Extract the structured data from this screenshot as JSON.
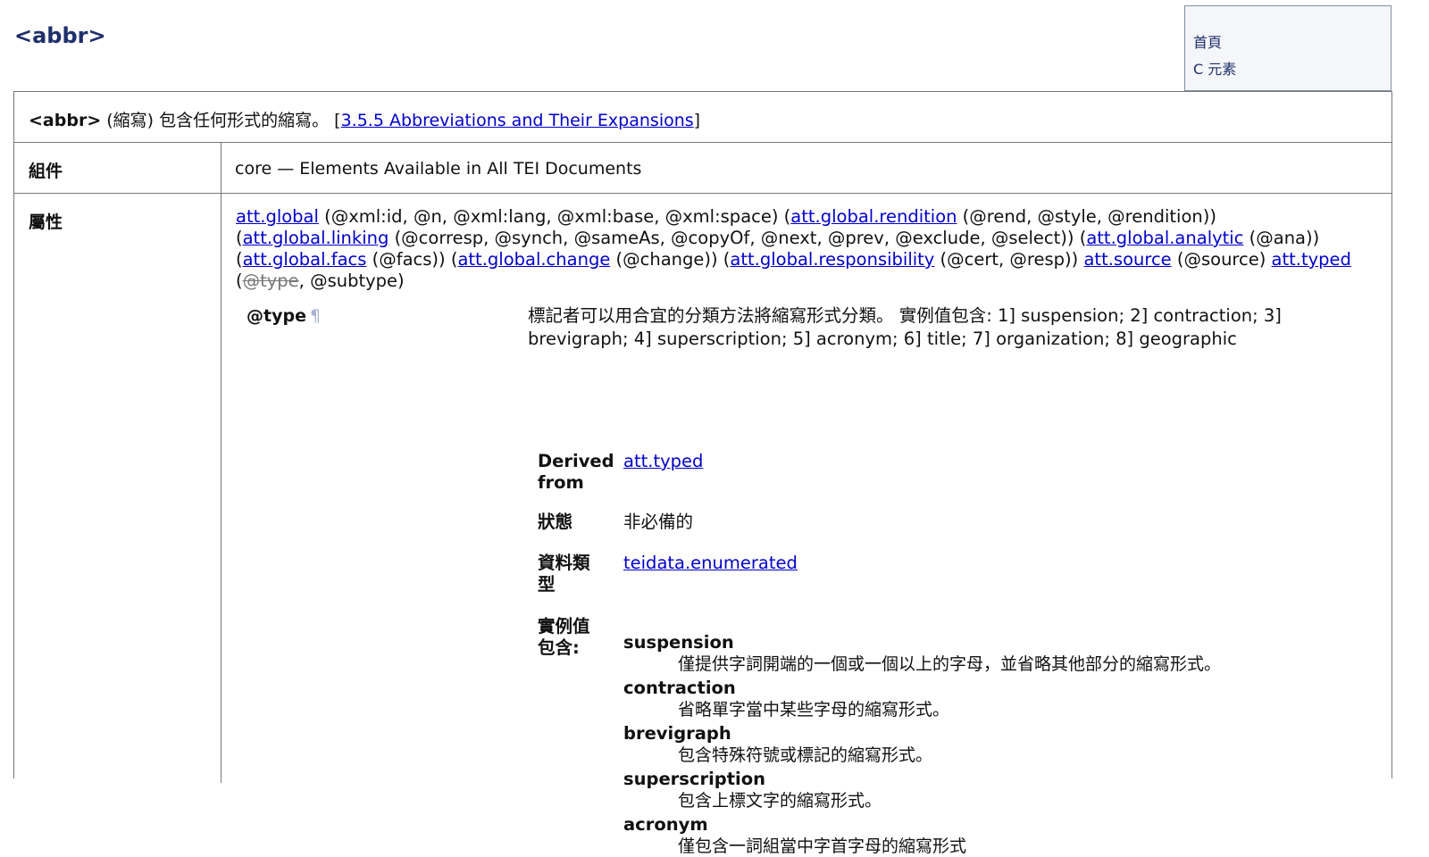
{
  "page": {
    "title": "<abbr>"
  },
  "nav": {
    "items": [
      "首頁",
      "C 元素"
    ]
  },
  "header_row": {
    "element": "<abbr>",
    "gloss": " (縮寫) 包含任何形式的縮寫。 [",
    "link": "3.5.5 Abbreviations and Their Expansions",
    "close": "]"
  },
  "module_row": {
    "label": "組件",
    "value": "core — Elements Available in All TEI Documents"
  },
  "attributes_row": {
    "label": "屬性",
    "classes": {
      "global": "att.global",
      "global_attrs": " (@xml:id, @n, @xml:lang, @xml:base, @xml:space) (",
      "rendition": "att.global.rendition",
      "rendition_attrs": " (@rend, @style, @rendition))",
      "open1": "(",
      "linking": "att.global.linking",
      "linking_attrs": " (@corresp, @synch, @sameAs, @copyOf, @next, @prev, @exclude, @select)) (",
      "analytic": "att.global.analytic",
      "analytic_attrs": " (@ana))",
      "open2": "(",
      "facs": "att.global.facs",
      "facs_attrs": " (@facs)) (",
      "change": "att.global.change",
      "change_attrs": " (@change)) (",
      "responsibility": "att.global.responsibility",
      "responsibility_attrs": " (@cert, @resp)) ",
      "source": "att.source",
      "source_attrs": " (@source) ",
      "typed": "att.typed",
      "open3": "(",
      "type_struck": "@type",
      "subtype": ", @subtype)"
    },
    "type_attr": {
      "name": "@type",
      "pilcrow": "¶",
      "description": "標記者可以用合宜的分類方法將縮寫形式分類。 實例值包含: 1] suspension; 2] contraction; 3] brevigraph; 4] superscription; 5] acronym; 6] title; 7] organization; 8] geographic",
      "derived_label": "Derived from",
      "derived_value": "att.typed",
      "status_label": "狀態",
      "status_value": "非必備的",
      "datatype_label": "資料類型",
      "datatype_value": "teidata.enumerated",
      "values_label": "實例值包含:",
      "values": [
        {
          "term": "suspension",
          "desc": "僅提供字詞開端的一個或一個以上的字母，並省略其他部分的縮寫形式。"
        },
        {
          "term": "contraction",
          "desc": "省略單字當中某些字母的縮寫形式。"
        },
        {
          "term": "brevigraph",
          "desc": "包含特殊符號或標記的縮寫形式。"
        },
        {
          "term": "superscription",
          "desc": "包含上標文字的縮寫形式。"
        },
        {
          "term": "acronym",
          "desc": "僅包含一詞組當中字首字母的縮寫形式"
        }
      ]
    }
  }
}
